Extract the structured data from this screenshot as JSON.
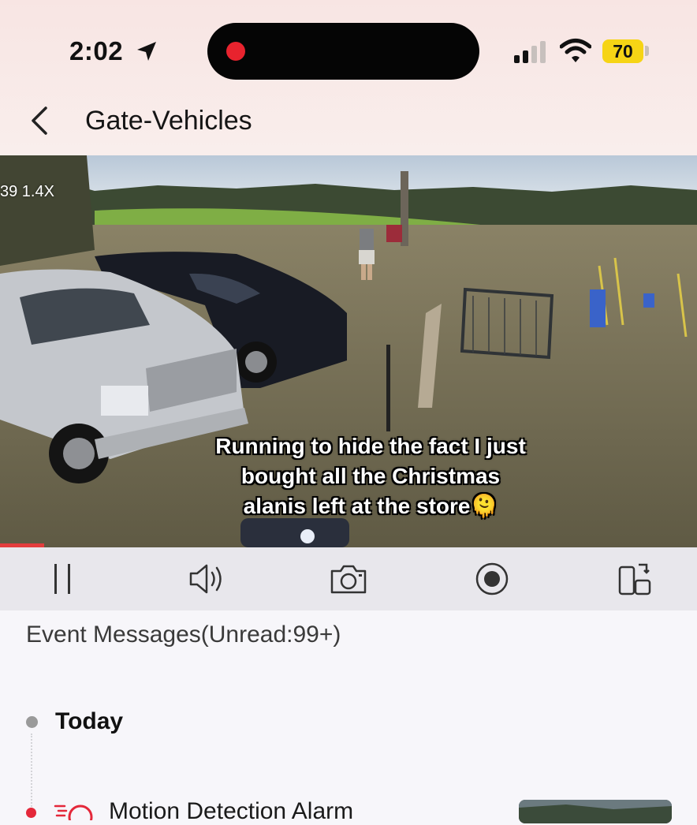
{
  "status_bar": {
    "time": "2:02",
    "battery": "70",
    "icons": [
      "location-arrow-icon",
      "recording-dot-icon",
      "cell-signal-icon",
      "wifi-icon",
      "battery-icon"
    ]
  },
  "header": {
    "title": "Gate-Vehicles",
    "back_icon": "chevron-left-icon"
  },
  "video": {
    "zoom_label": "39  1.4X",
    "caption_line1": "Running to hide the fact I just",
    "caption_line2": "bought all the Christmas",
    "caption_line3": "alanis left at the store🫠"
  },
  "controls": {
    "items": [
      "pause-icon",
      "speaker-icon",
      "camera-icon",
      "record-icon",
      "screen-rotate-icon"
    ]
  },
  "events": {
    "title": "Event Messages(Unread:99+)",
    "group_label": "Today",
    "first_event": "Motion Detection Alarm"
  },
  "colors": {
    "header_bg": "#f8e5e3",
    "battery": "#f6d415",
    "recording": "#e8232e",
    "alarm": "#e4283a",
    "control_bar": "#e8e7ec"
  }
}
